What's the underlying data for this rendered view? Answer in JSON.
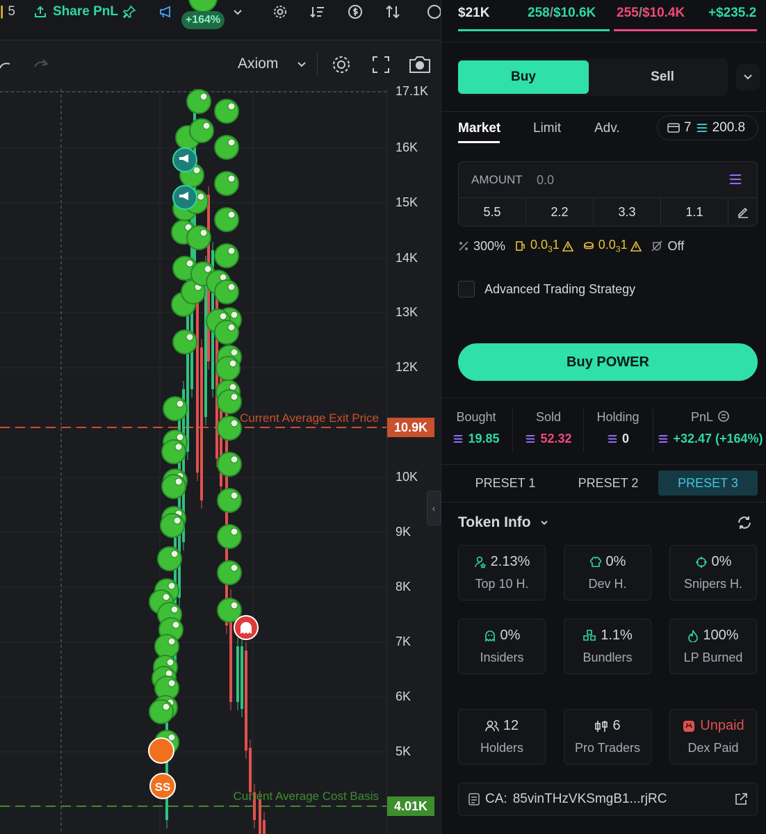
{
  "topbar": {
    "tab_count": "5",
    "share_pnl_label": "Share PnL",
    "pnl_badge": "+164%"
  },
  "toolbar": {
    "chart_style": "Axiom"
  },
  "chart": {
    "y_ticks": [
      "17.1K",
      "16K",
      "15K",
      "14K",
      "13K",
      "12K",
      "10.9K",
      "10K",
      "9K",
      "8K",
      "7K",
      "6K",
      "5K",
      "4.01K"
    ],
    "exit_price_label": "Current Average Exit Price",
    "exit_price_tag": "10.9K",
    "cost_basis_label": "Current Average Cost Basis",
    "cost_basis_tag": "4.01K",
    "sell_marker_label": "SS",
    "colors": {
      "up": "#2ec27e",
      "down": "#e0514e",
      "exit": "#c8512e",
      "cost": "#3e8e2e"
    }
  },
  "stats": {
    "mcap": "$21K",
    "buys": "258",
    "buys_value": "$10.6K",
    "sells": "255",
    "sells_value": "$10.4K",
    "pnl_value": "+$235.2"
  },
  "trade": {
    "buy_label": "Buy",
    "sell_label": "Sell",
    "order_tabs": [
      "Market",
      "Limit",
      "Adv."
    ],
    "wallets": "7",
    "balance": "200.8",
    "amount_label": "AMOUNT",
    "amount_placeholder": "0.0",
    "presets": [
      "5.5",
      "2.2",
      "3.3",
      "1.1"
    ],
    "slippage": "300%",
    "priority_prefix": "0.0",
    "priority_sub": "3",
    "priority_suffix": "1",
    "bribe_prefix": "0.0",
    "bribe_sub": "3",
    "bribe_suffix": "1",
    "mev": "Off",
    "advanced_label": "Advanced Trading Strategy",
    "buy_button": "Buy POWER"
  },
  "position": {
    "bought_label": "Bought",
    "bought": "19.85",
    "sold_label": "Sold",
    "sold": "52.32",
    "holding_label": "Holding",
    "holding": "0",
    "pnl_label": "PnL",
    "pnl": "+32.47 (+164%)"
  },
  "preset_tabs": [
    "PRESET 1",
    "PRESET 2",
    "PRESET 3"
  ],
  "token_info": {
    "title": "Token Info",
    "cards": [
      {
        "value": "2.13%",
        "label": "Top 10 H.",
        "color": "#2ed8a6"
      },
      {
        "value": "0%",
        "label": "Dev H.",
        "color": "#2ed8a6"
      },
      {
        "value": "0%",
        "label": "Snipers H.",
        "color": "#2ed8a6"
      },
      {
        "value": "0%",
        "label": "Insiders",
        "color": "#2ed8a6"
      },
      {
        "value": "1.1%",
        "label": "Bundlers",
        "color": "#2ed8a6"
      },
      {
        "value": "100%",
        "label": "LP Burned",
        "color": "#2ed8a6"
      },
      {
        "value": "12",
        "label": "Holders",
        "color": "#d6d8de"
      },
      {
        "value": "6",
        "label": "Pro Traders",
        "color": "#d6d8de"
      },
      {
        "value": "Unpaid",
        "label": "Dex Paid",
        "color": "#e0514e"
      }
    ],
    "ca_label": "CA:",
    "ca_value": "85vinTHzVKSmgB1...rjRC"
  }
}
